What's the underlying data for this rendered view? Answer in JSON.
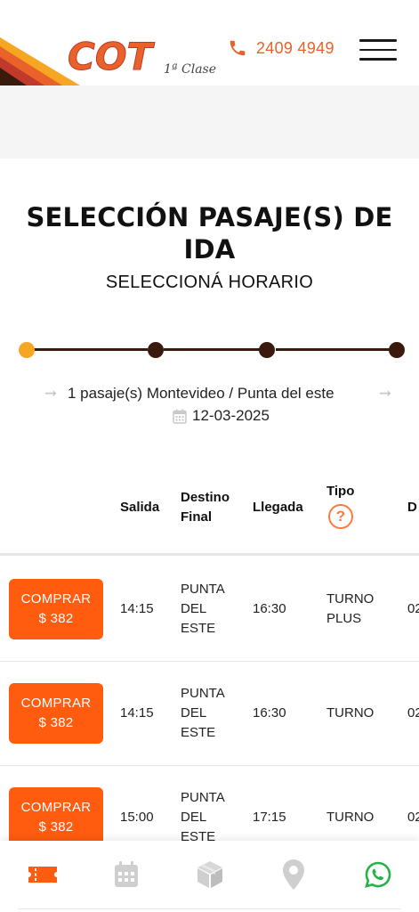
{
  "header": {
    "logo_text": "COT",
    "logo_sub": "1ª Clase",
    "phone": "2409 4949",
    "phone_icon": "phone-icon",
    "menu_icon": "hamburger-icon"
  },
  "page": {
    "title": "SELECCIÓN PASAJE(S) DE IDA",
    "subtitle": "SELECCIONÁ HORARIO"
  },
  "stepper": {
    "total_steps": 4,
    "current_step": 1
  },
  "trip": {
    "summary": "1 pasaje(s) Montevideo / Punta del este",
    "date": "12-03-2025",
    "arrow_icon": "arrow-right-icon",
    "calendar_icon": "calendar-icon"
  },
  "table": {
    "columns": {
      "salida": "Salida",
      "destino": "Destino Final",
      "llegada": "Llegada",
      "tipo": "Tipo",
      "extra": "D"
    },
    "help_icon": "question-circle-icon",
    "rows": [
      {
        "buy_label": "COMPRAR",
        "price": "$ 382",
        "salida": "14:15",
        "destino": "PUNTA DEL ESTE",
        "llegada": "16:30",
        "tipo": "TURNO PLUS",
        "extra": "02"
      },
      {
        "buy_label": "COMPRAR",
        "price": "$ 382",
        "salida": "14:15",
        "destino": "PUNTA DEL ESTE",
        "llegada": "16:30",
        "tipo": "TURNO",
        "extra": "02"
      },
      {
        "buy_label": "COMPRAR",
        "price": "$ 382",
        "salida": "15:00",
        "destino": "PUNTA DEL ESTE",
        "llegada": "17:15",
        "tipo": "TURNO",
        "extra": "02"
      }
    ]
  },
  "bottom_nav": {
    "items": [
      "ticket-icon",
      "calendar-icon",
      "package-icon",
      "location-pin-icon",
      "whatsapp-icon"
    ]
  },
  "colors": {
    "accent": "#ff5c10",
    "brand_orange": "#e8622a",
    "stepper_dark": "#3b1a0e",
    "stepper_active": "#f5a623",
    "whatsapp": "#25b24a"
  }
}
